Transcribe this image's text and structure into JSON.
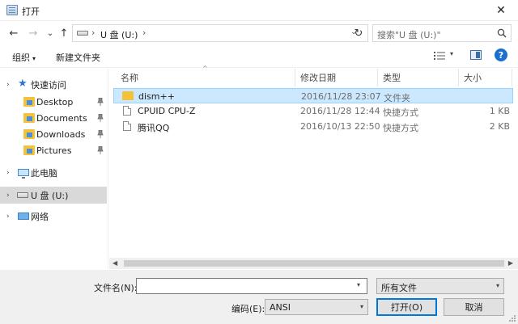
{
  "window": {
    "title": "打开",
    "close_glyph": "✕"
  },
  "nav": {
    "back": "←",
    "forward": "→",
    "recent": "⌄",
    "up": "↑",
    "refresh": "↻"
  },
  "address": {
    "separator": "›",
    "path": "U 盘 (U:)",
    "drop": "⌄"
  },
  "search": {
    "placeholder": "搜索\"U 盘 (U:)\""
  },
  "toolbar": {
    "organize": "组织",
    "organize_caret": "▾",
    "new_folder": "新建文件夹",
    "view_caret": "▾",
    "help": "?"
  },
  "sidebar": {
    "quick_access": "快速访问",
    "items": [
      {
        "label": "Desktop"
      },
      {
        "label": "Documents"
      },
      {
        "label": "Downloads"
      },
      {
        "label": "Pictures"
      }
    ],
    "this_pc": "此电脑",
    "drive": "U 盘 (U:)",
    "network": "网络",
    "chevron": "›"
  },
  "columns": {
    "name": "名称",
    "date": "修改日期",
    "type": "类型",
    "size": "大小",
    "sort": "^"
  },
  "files": [
    {
      "name": "dism++",
      "date": "2016/11/28 23:07",
      "type": "文件夹",
      "size": ""
    },
    {
      "name": "CPUID CPU-Z",
      "date": "2016/11/28 12:44",
      "type": "快捷方式",
      "size": "1 KB"
    },
    {
      "name": "腾讯QQ",
      "date": "2016/10/13 22:50",
      "type": "快捷方式",
      "size": "2 KB"
    }
  ],
  "scroll": {
    "left": "◀",
    "right": "▶"
  },
  "bottom": {
    "filename_label": "文件名(N):",
    "filename_value": "",
    "filetype": "所有文件",
    "encoding_label": "编码(E):",
    "encoding": "ANSI",
    "open": "打开(O)",
    "cancel": "取消",
    "caret": "▾"
  },
  "colors": {
    "selection": "#cce8ff",
    "selection_border": "#99d1ff",
    "accent": "#0078d7",
    "folder": "#f3c13a"
  }
}
